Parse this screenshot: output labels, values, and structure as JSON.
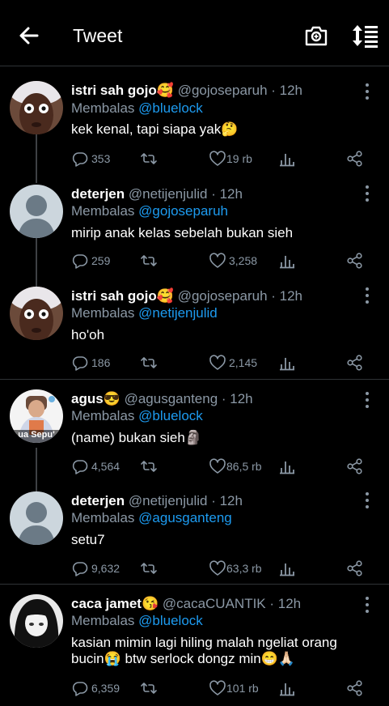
{
  "header": {
    "title": "Tweet"
  },
  "tweets": [
    {
      "name": "istri sah gojo🥰",
      "handle": "@gojoseparuh · 12h",
      "reply_prefix": "Membalas",
      "reply_to": "@bluelock",
      "text": "kek kenal, tapi siapa yak🤔",
      "replies": "353",
      "likes": "19 rb",
      "avatar": "face-photo-avatar"
    },
    {
      "name": "deterjen",
      "handle": "@netijenjulid · 12h",
      "reply_prefix": "Membalas",
      "reply_to": "@gojoseparuh",
      "text": "mirip anak kelas sebelah bukan sieh",
      "replies": "259",
      "likes": "3,258",
      "avatar": "default-avatar"
    },
    {
      "name": "istri sah gojo🥰",
      "handle": "@gojoseparuh · 12h",
      "reply_prefix": "Membalas",
      "reply_to": "@netijenjulid",
      "text": "ho'oh",
      "replies": "186",
      "likes": "2,145",
      "avatar": "face-photo-avatar"
    },
    {
      "name": "agus😎",
      "handle": "@agusganteng · 12h",
      "reply_prefix": "Membalas",
      "reply_to": "@bluelock",
      "text": "(name) bukan sieh🗿",
      "replies": "4,564",
      "likes": "86,5 rb",
      "avatar": "meme-avatar",
      "avatar_caption": "ua Sepu'"
    },
    {
      "name": "deterjen",
      "handle": "@netijenjulid · 12h",
      "reply_prefix": "Membalas",
      "reply_to": "@agusganteng",
      "text": "setu7",
      "replies": "9,632",
      "likes": "63,3 rb",
      "avatar": "default-avatar"
    },
    {
      "name": "caca jamet😘",
      "handle": "@cacaCUANTIK · 12h",
      "reply_prefix": "Membalas",
      "reply_to": "@bluelock",
      "text": "kasian mimin lagi hiling malah ngeliat orang bucin😭 btw serlock dongz min😁🙏🏻",
      "replies": "6,359",
      "likes": "101 rb",
      "avatar": "anime-avatar"
    }
  ],
  "colors": {
    "background": "#000000",
    "link": "#1d9bf0",
    "muted": "#8b98a5",
    "divider": "#2f3336"
  },
  "icons": [
    "back-arrow-icon",
    "camera-icon",
    "sort-icon",
    "more-vertical-icon",
    "reply-icon",
    "retweet-icon",
    "heart-icon",
    "analytics-icon",
    "share-icon"
  ]
}
